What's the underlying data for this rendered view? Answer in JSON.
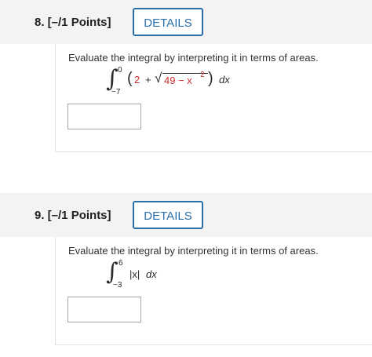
{
  "questions": [
    {
      "title": "8. [–/1 Points]",
      "details_label": "DETAILS",
      "prompt": "Evaluate the integral by interpreting it in terms of areas.",
      "integral": {
        "upper": "0",
        "lower": "−7",
        "open_paren": "(",
        "term_a": "2",
        "plus": "+",
        "radical": "√",
        "radicand_a": "49 − x",
        "exponent": "2",
        "close_paren": ")",
        "dx": "dx"
      }
    },
    {
      "title": "9. [–/1 Points]",
      "details_label": "DETAILS",
      "prompt": "Evaluate the integral by interpreting it in terms of areas.",
      "integral": {
        "upper": "6",
        "lower": "−3",
        "integrand": "|x|",
        "dx": "dx"
      }
    }
  ],
  "colors": {
    "accent": "#2a6fa8",
    "highlight_red": "#d22f2f",
    "header_bg": "#f3f3f3"
  }
}
